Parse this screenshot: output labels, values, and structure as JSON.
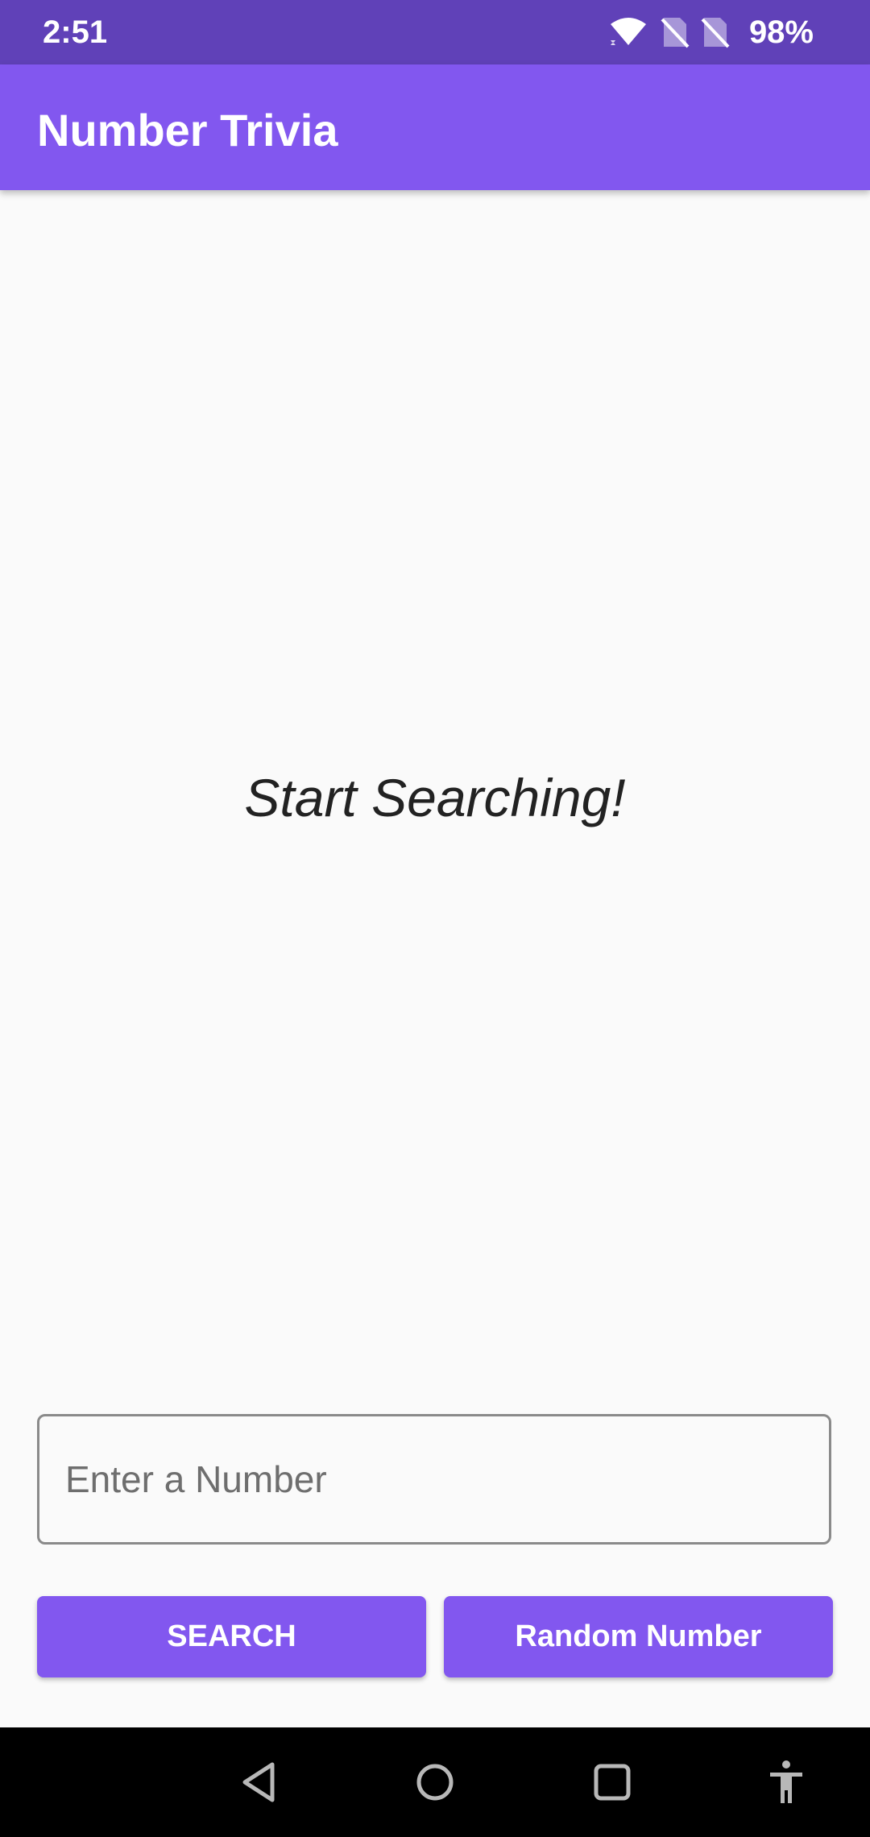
{
  "status_bar": {
    "time": "2:51",
    "battery": "98%",
    "icons": [
      "wifi-icon",
      "no-sim-icon",
      "no-sim-icon"
    ],
    "color": "#6041b8"
  },
  "app_bar": {
    "title": "Number Trivia",
    "color": "#8257ef"
  },
  "main": {
    "message": "Start Searching!"
  },
  "input": {
    "placeholder": "Enter a Number",
    "value": ""
  },
  "buttons": {
    "search_label": "SEARCH",
    "random_label": "Random Number"
  },
  "nav_bar": {
    "items": [
      "back-icon",
      "home-icon",
      "recents-icon",
      "accessibility-icon"
    ]
  }
}
